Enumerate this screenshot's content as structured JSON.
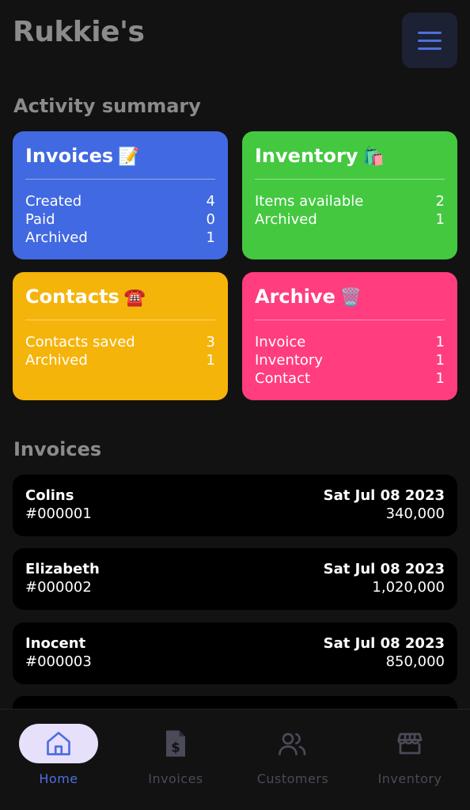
{
  "header": {
    "title": "Rukkie's"
  },
  "summary": {
    "heading": "Activity summary",
    "cards": [
      {
        "title": "Invoices",
        "emoji": "📝",
        "color": "#4169e1",
        "rows": [
          {
            "label": "Created",
            "value": "4"
          },
          {
            "label": "Paid",
            "value": "0"
          },
          {
            "label": "Archived",
            "value": "1"
          }
        ]
      },
      {
        "title": "Inventory",
        "emoji": "🛍️",
        "color": "#44c840",
        "rows": [
          {
            "label": "Items available",
            "value": "2"
          },
          {
            "label": "Archived",
            "value": "1"
          }
        ]
      },
      {
        "title": "Contacts",
        "emoji": "☎️",
        "color": "#f5b40a",
        "rows": [
          {
            "label": "Contacts saved",
            "value": "3"
          },
          {
            "label": "Archived",
            "value": "1"
          }
        ]
      },
      {
        "title": "Archive",
        "emoji": "🗑️",
        "color": "#ff3d7f",
        "rows": [
          {
            "label": "Invoice",
            "value": "1"
          },
          {
            "label": "Inventory",
            "value": "1"
          },
          {
            "label": "Contact",
            "value": "1"
          }
        ]
      }
    ]
  },
  "invoices": {
    "heading": "Invoices",
    "items": [
      {
        "name": "Colins",
        "number": "#000001",
        "date": "Sat Jul 08 2023",
        "amount": "340,000"
      },
      {
        "name": "Elizabeth",
        "number": "#000002",
        "date": "Sat Jul 08 2023",
        "amount": "1,020,000"
      },
      {
        "name": "Inocent",
        "number": "#000003",
        "date": "Sat Jul 08 2023",
        "amount": "850,000"
      }
    ]
  },
  "nav": {
    "active_color": "#4f6fe0",
    "active_bg": "#e6e0fb",
    "inactive_color": "#4a4a58",
    "items": [
      {
        "label": "Home",
        "icon": "home-icon",
        "active": true
      },
      {
        "label": "Invoices",
        "icon": "invoice-icon",
        "active": false
      },
      {
        "label": "Customers",
        "icon": "users-icon",
        "active": false
      },
      {
        "label": "Inventory",
        "icon": "store-icon",
        "active": false
      }
    ]
  }
}
